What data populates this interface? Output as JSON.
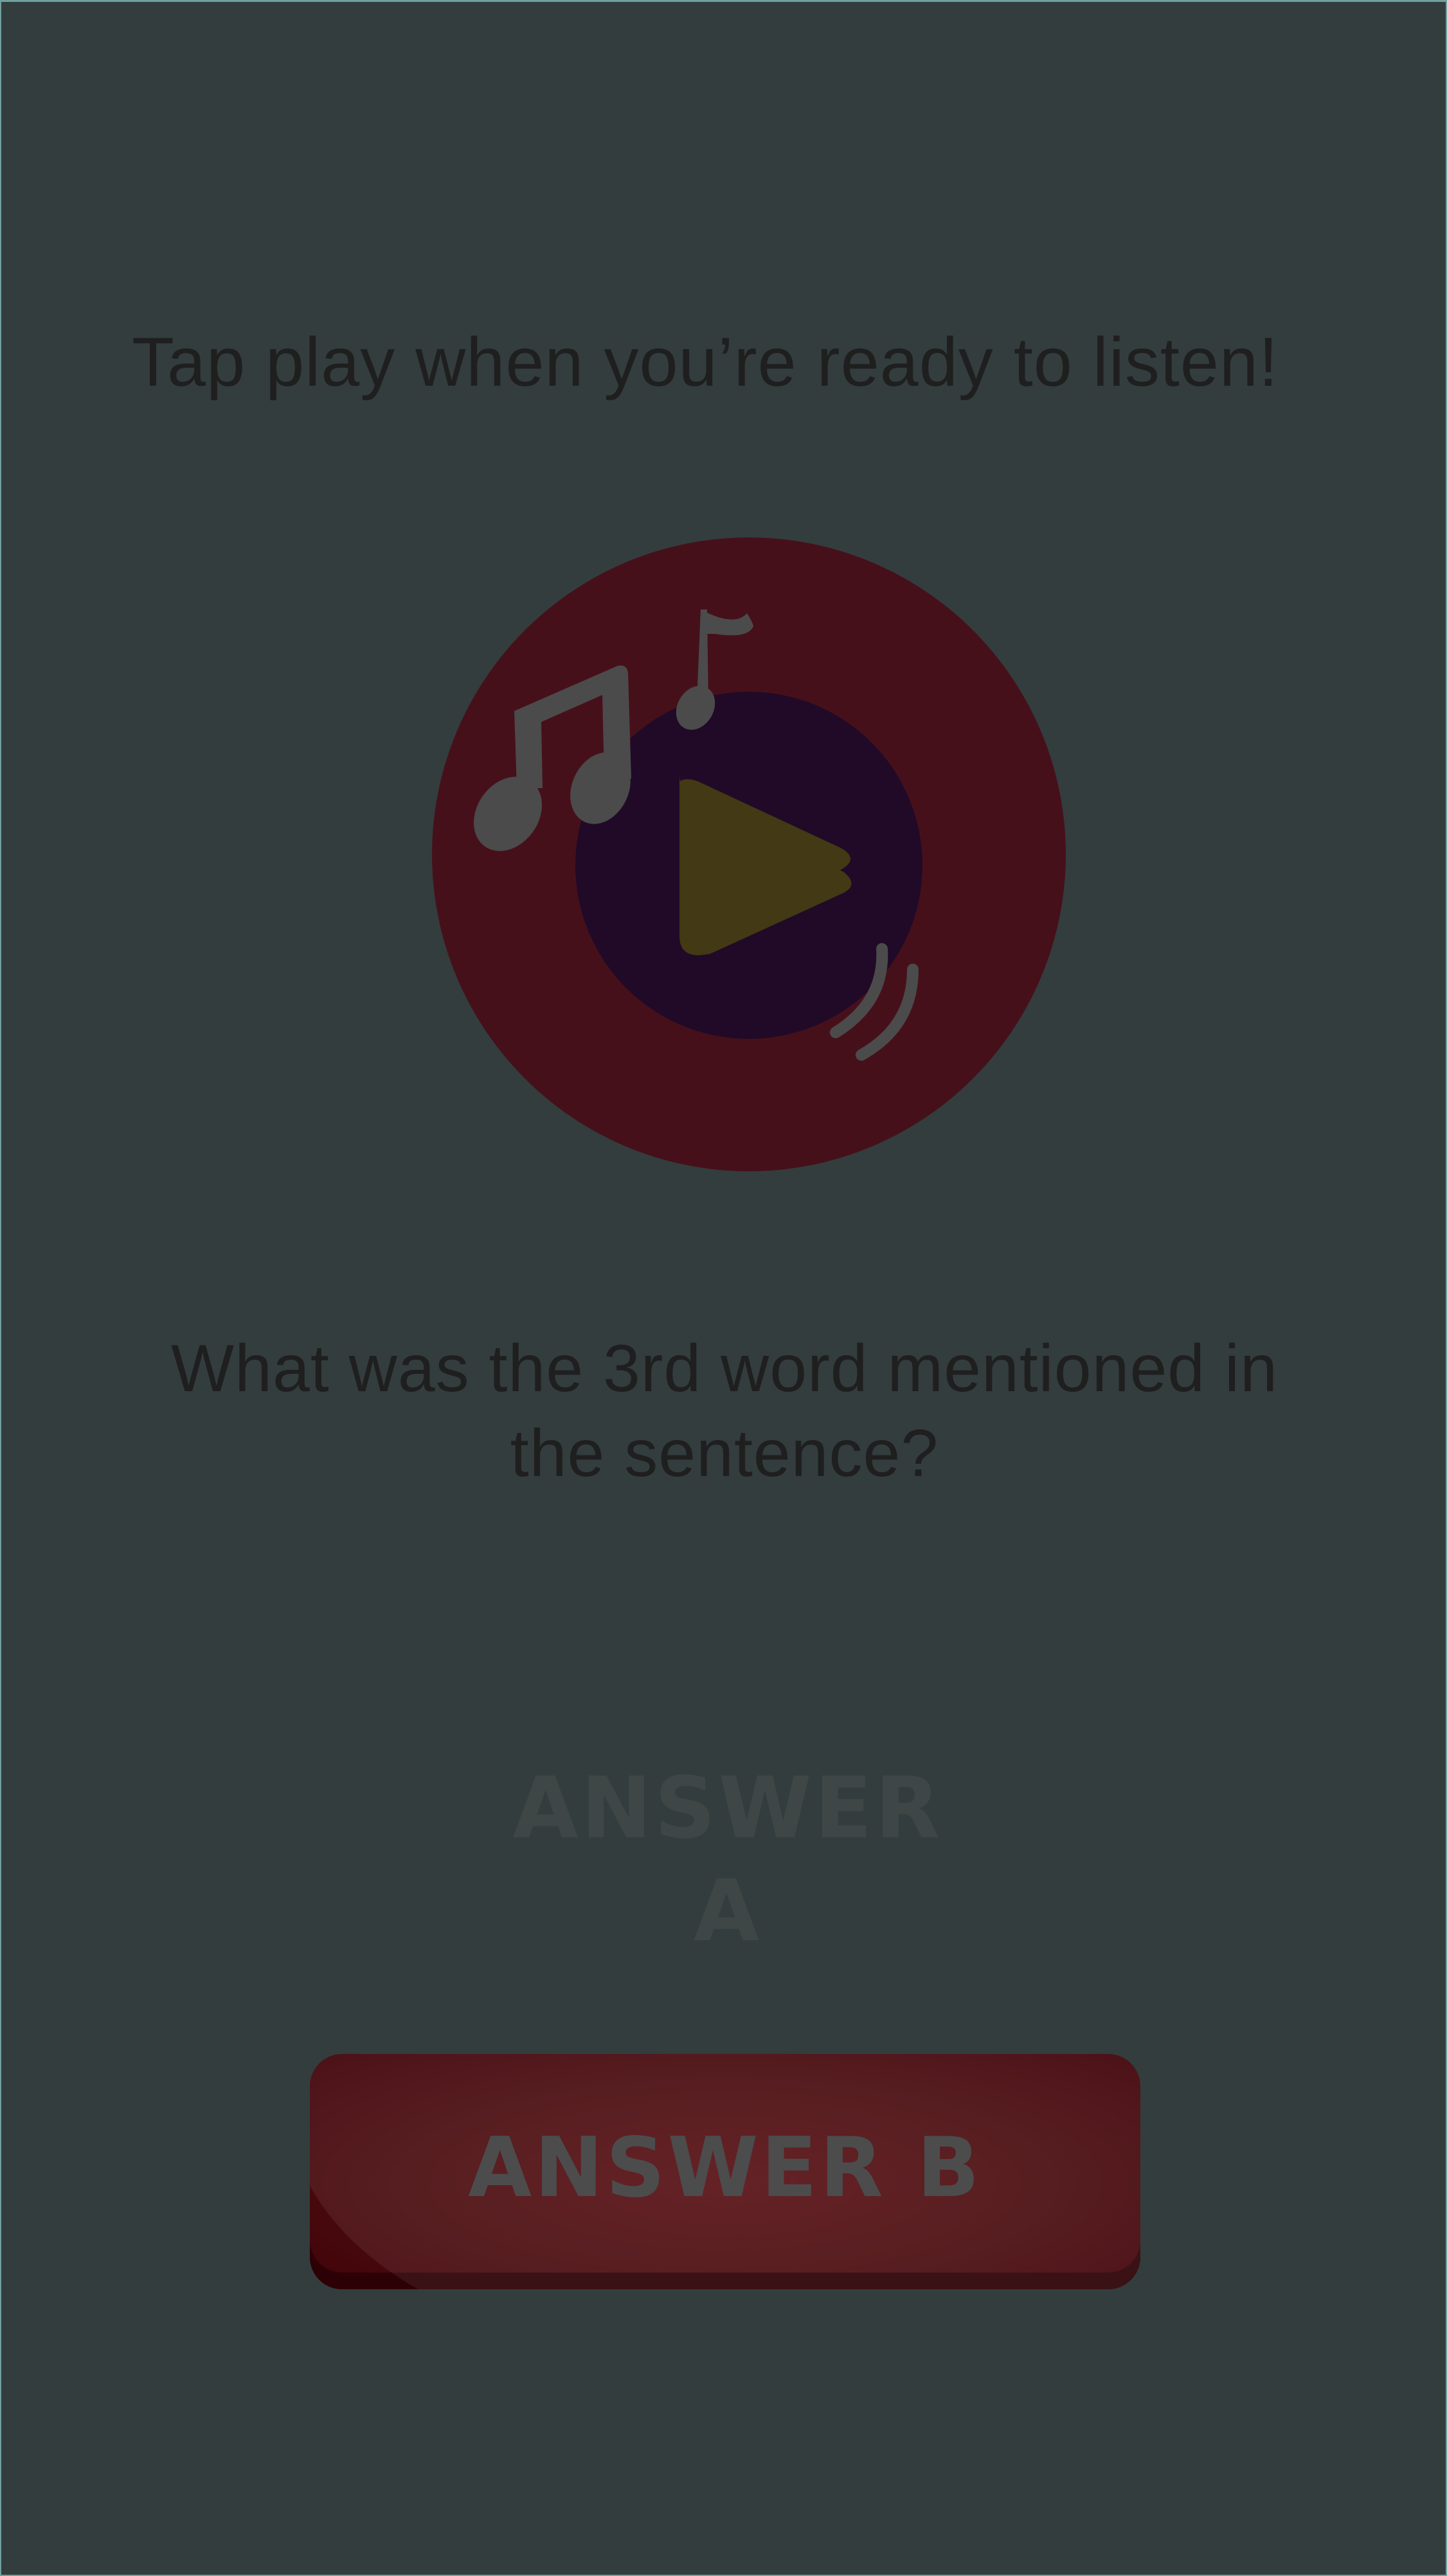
{
  "screen": {
    "prompt_text": "Tap play when you’re ready to listen!",
    "question_text": "What was the 3rd word mentioned in the sentence?"
  },
  "player": {
    "icon": "music-play-icon",
    "colors": {
      "outer_circle": "#46101a",
      "inner_circle": "#200a28",
      "play_triangle": "#433914",
      "notes": "#4b4b4b"
    }
  },
  "answers": [
    {
      "label": "ANSWER A",
      "selected": false
    },
    {
      "label": "ANSWER B",
      "selected": true,
      "color": "#4a0d10"
    }
  ],
  "background_color": "#333d3d"
}
